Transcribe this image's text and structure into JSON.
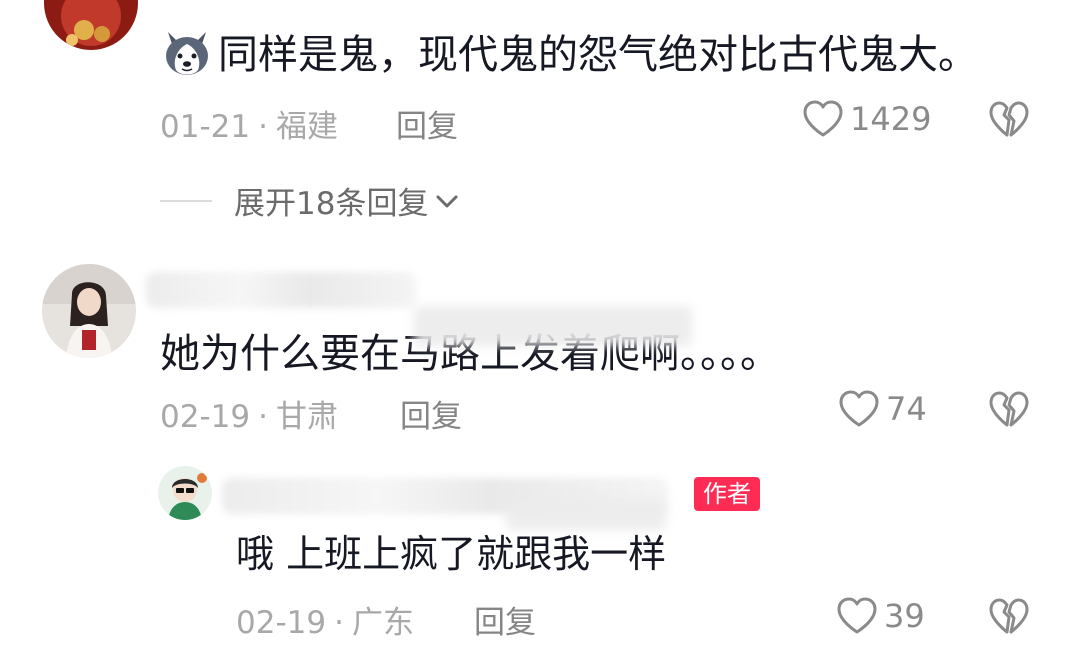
{
  "comments": [
    {
      "text": "同样是鬼，现代鬼的怨气绝对比古代鬼大。",
      "emoji": "husky-dog-emoji",
      "date": "01-21",
      "separator": "·",
      "location": "福建",
      "reply_label": "回复",
      "likes": "1429",
      "expand_replies": "展开18条回复"
    },
    {
      "text": "她为什么要在马路上发着爬啊。。。。",
      "date": "02-19",
      "separator": "·",
      "location": "甘肃",
      "reply_label": "回复",
      "likes": "74",
      "reply": {
        "author_badge": "作者",
        "text": "哦 上班上疯了就跟我一样",
        "date": "02-19",
        "separator": "·",
        "location": "广东",
        "reply_label": "回复",
        "likes": "39"
      }
    }
  ],
  "colors": {
    "author_badge_bg": "#fe2c55",
    "meta_text": "#a8a8a8",
    "primary_text": "#161823"
  },
  "icons": {
    "like": "heart-outline-icon",
    "dislike": "broken-heart-icon",
    "expand": "chevron-down-icon"
  }
}
